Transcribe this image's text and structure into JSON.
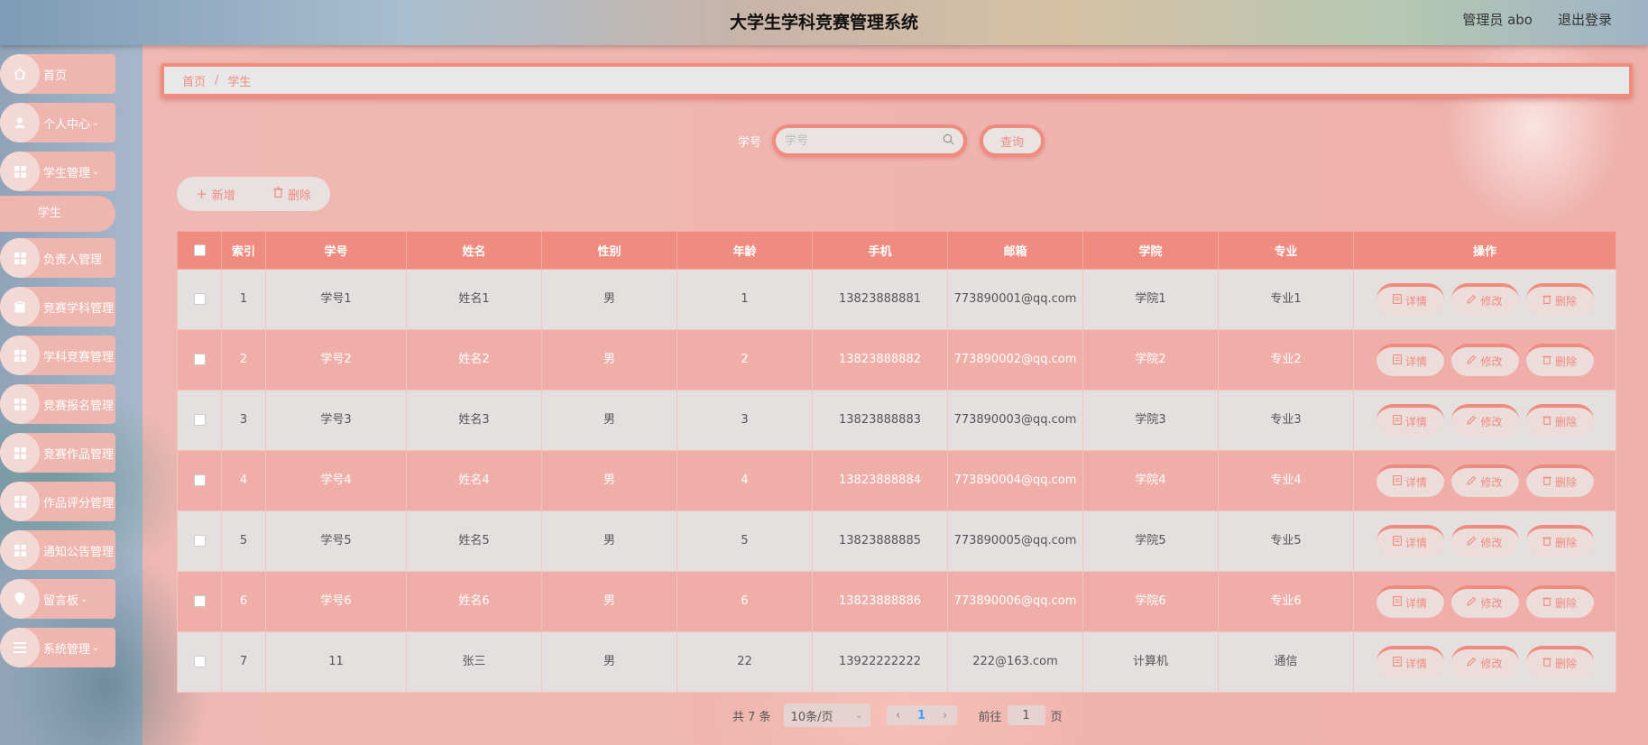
{
  "header": {
    "title": "大学生学科竞赛管理系统",
    "user": "管理员 abo",
    "logout": "退出登录"
  },
  "sidebar": {
    "items": [
      {
        "label": "首页",
        "icon": "home-icon",
        "chev": ""
      },
      {
        "label": "个人中心",
        "icon": "user-icon",
        "chev": "⌄"
      },
      {
        "label": "学生管理",
        "icon": "grid-icon",
        "chev": "⌄"
      },
      {
        "label": "学生",
        "icon": "",
        "chev": ""
      },
      {
        "label": "负责人管理",
        "icon": "grid-icon",
        "chev": ""
      },
      {
        "label": "竞赛学科管理",
        "icon": "clipboard-icon",
        "chev": ""
      },
      {
        "label": "学科竞赛管理",
        "icon": "grid-icon",
        "chev": ""
      },
      {
        "label": "竞赛报名管理",
        "icon": "grid-icon",
        "chev": ""
      },
      {
        "label": "竞赛作品管理",
        "icon": "grid-icon",
        "chev": ""
      },
      {
        "label": "作品评分管理",
        "icon": "grid-icon",
        "chev": ""
      },
      {
        "label": "通知公告管理",
        "icon": "grid-icon",
        "chev": ""
      },
      {
        "label": "留言板",
        "icon": "pin-icon",
        "chev": "⌄"
      },
      {
        "label": "系统管理",
        "icon": "menu-icon",
        "chev": "⌄"
      }
    ]
  },
  "breadcrumb": {
    "home": "首页",
    "sep": "/",
    "current": "学生"
  },
  "search": {
    "label": "学号",
    "placeholder": "学号",
    "button": "查询"
  },
  "actions": {
    "add": "新增",
    "delete": "删除"
  },
  "table": {
    "headers": [
      "",
      "索引",
      "学号",
      "姓名",
      "性别",
      "年龄",
      "手机",
      "邮箱",
      "学院",
      "专业",
      "操作"
    ],
    "rows": [
      {
        "index": "1",
        "id": "学号1",
        "name": "姓名1",
        "gender": "男",
        "age": "1",
        "phone": "13823888881",
        "email": "773890001@qq.com",
        "college": "学院1",
        "major": "专业1"
      },
      {
        "index": "2",
        "id": "学号2",
        "name": "姓名2",
        "gender": "男",
        "age": "2",
        "phone": "13823888882",
        "email": "773890002@qq.com",
        "college": "学院2",
        "major": "专业2"
      },
      {
        "index": "3",
        "id": "学号3",
        "name": "姓名3",
        "gender": "男",
        "age": "3",
        "phone": "13823888883",
        "email": "773890003@qq.com",
        "college": "学院3",
        "major": "专业3"
      },
      {
        "index": "4",
        "id": "学号4",
        "name": "姓名4",
        "gender": "男",
        "age": "4",
        "phone": "13823888884",
        "email": "773890004@qq.com",
        "college": "学院4",
        "major": "专业4"
      },
      {
        "index": "5",
        "id": "学号5",
        "name": "姓名5",
        "gender": "男",
        "age": "5",
        "phone": "13823888885",
        "email": "773890005@qq.com",
        "college": "学院5",
        "major": "专业5"
      },
      {
        "index": "6",
        "id": "学号6",
        "name": "姓名6",
        "gender": "男",
        "age": "6",
        "phone": "13823888886",
        "email": "773890006@qq.com",
        "college": "学院6",
        "major": "专业6"
      },
      {
        "index": "7",
        "id": "11",
        "name": "张三",
        "gender": "男",
        "age": "22",
        "phone": "13922222222",
        "email": "222@163.com",
        "college": "计算机",
        "major": "通信"
      }
    ],
    "ops": {
      "detail": "详情",
      "edit": "修改",
      "delete": "删除"
    }
  },
  "pager": {
    "total": "共 7 条",
    "size": "10条/页",
    "current": "1",
    "goto_prefix": "前往",
    "goto_value": "1",
    "goto_suffix": "页"
  },
  "colors": {
    "accent": "#ef8c7f",
    "row_alt": "#efafa8",
    "row": "#e3e0df"
  }
}
